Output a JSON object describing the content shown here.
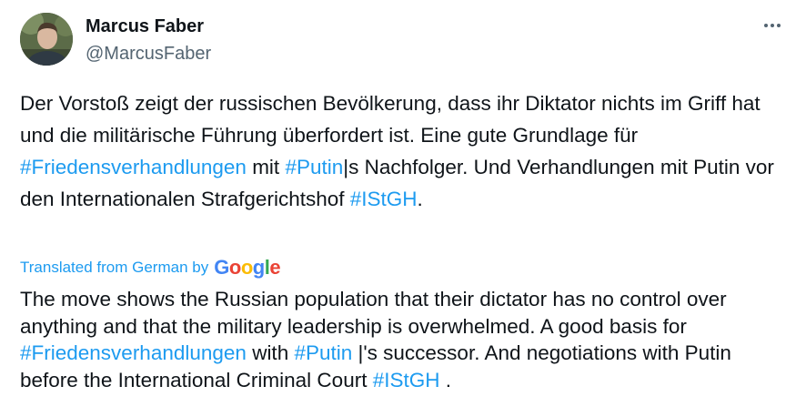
{
  "author": {
    "display_name": "Marcus Faber",
    "handle": "@MarcusFaber"
  },
  "more_menu": {
    "icon": "more-horizontal-icon"
  },
  "original": {
    "part1": "Der Vorstoß zeigt der russischen Bevölkerung, dass ihr Diktator nichts im Griff hat und die militärische Führung überfordert ist. Eine gute Grundlage für ",
    "hashtag1": "#Friedensverhandlungen",
    "part2": " mit ",
    "hashtag2": "#Putin",
    "part3": "|s Nachfolger. Und Verhandlungen mit Putin vor den Internationalen Strafgerichtshof ",
    "hashtag3": "#IStGH",
    "part4": "."
  },
  "translation_notice": {
    "label": "Translated from German by",
    "provider_logo_text": "Google"
  },
  "translation": {
    "part1": "The move shows the Russian population that their dictator has no control over anything and that the military leadership is overwhelmed. A good basis for ",
    "hashtag1": "#Friedensverhandlungen",
    "part2": " with ",
    "hashtag2": "#Putin",
    "part3": " |'s successor. And negotiations with Putin before the International Criminal Court ",
    "hashtag3": "#IStGH",
    "part4": " ."
  },
  "colors": {
    "link": "#1d9bf0",
    "text": "#0f1419",
    "secondary": "#536471"
  }
}
